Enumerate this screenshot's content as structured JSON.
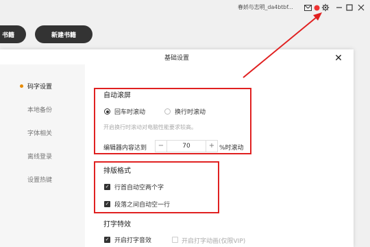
{
  "topbar": {
    "user_label": "春娇与志明_da4btbf...",
    "icons": [
      "mail-icon",
      "notification-badge-icon",
      "settings-icon",
      "minimize-icon",
      "maximize-icon",
      "close-icon"
    ]
  },
  "background": {
    "left_button_label": "书籍",
    "new_book_button_label": "新建书籍"
  },
  "dialog": {
    "title": "基础设置",
    "close_label": "✕"
  },
  "sidebar": {
    "items": [
      {
        "label": "码字设置",
        "active": true
      },
      {
        "label": "本地备份",
        "active": false
      },
      {
        "label": "字体相关",
        "active": false
      },
      {
        "label": "离线登录",
        "active": false
      },
      {
        "label": "设置热键",
        "active": false
      }
    ]
  },
  "auto_scroll": {
    "title": "自动滚屏",
    "option_enter": "回车时滚动",
    "option_newline": "换行时滚动",
    "hint": "开启换行时滚动对电脑性能要求较高。",
    "editor_label": "编辑器内容达到",
    "stepper_minus": "−",
    "stepper_value": "70",
    "stepper_plus": "+",
    "editor_suffix": "%时滚动"
  },
  "layout_format": {
    "title": "排版格式",
    "option_indent": "行首自动空两个字",
    "option_blankline": "段落之间自动空一行"
  },
  "typing_effect": {
    "title": "打字特效",
    "option_sound": "开启打字音效",
    "option_anim": "开启打字动画(仅限VIP)"
  },
  "colors": {
    "annotation_red": "#e02020",
    "active_dot": "#e68a00"
  }
}
